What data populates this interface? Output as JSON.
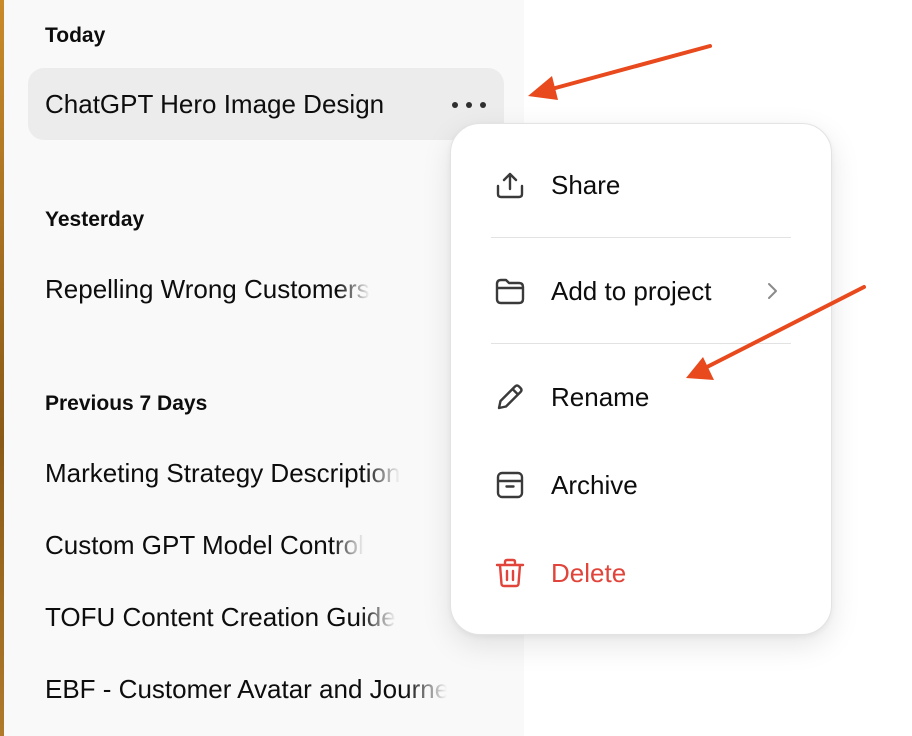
{
  "sidebar": {
    "sections": [
      {
        "heading": "Today"
      },
      {
        "heading": "Yesterday"
      },
      {
        "heading": "Previous 7 Days"
      }
    ],
    "active_chat": "ChatGPT Hero Image Design",
    "yesterday_chat": "Repelling Wrong Customers",
    "previous_chats": [
      "Marketing Strategy Description",
      "Custom GPT Model Control",
      "TOFU Content Creation Guide",
      "EBF - Customer Avatar and Journey"
    ]
  },
  "menu": {
    "items": [
      {
        "label": "Share",
        "icon": "share-icon"
      },
      {
        "label": "Add to project",
        "icon": "folder-icon"
      },
      {
        "label": "Rename",
        "icon": "pencil-icon"
      },
      {
        "label": "Archive",
        "icon": "archive-icon"
      },
      {
        "label": "Delete",
        "icon": "trash-icon"
      }
    ]
  },
  "colors": {
    "annotation_arrow": "#e8491d",
    "danger": "#e0443a",
    "sidebar_bg": "#f9f9f9",
    "active_bg": "#ececec"
  }
}
